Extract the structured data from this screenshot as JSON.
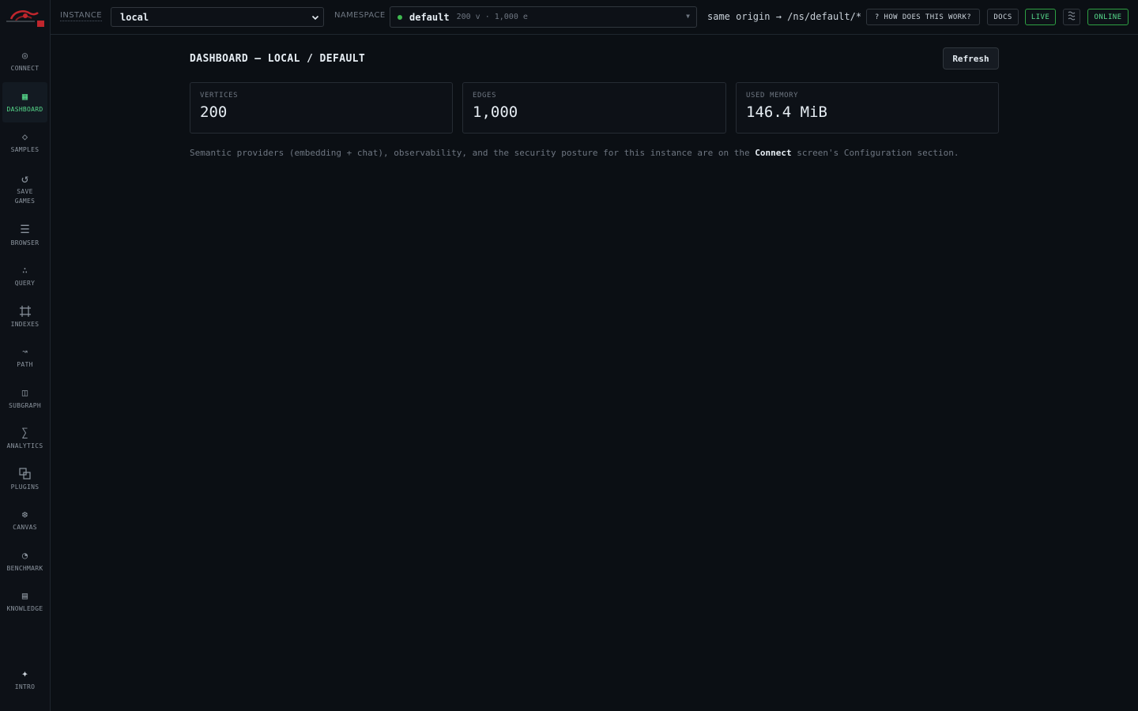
{
  "app": {
    "accent": "#56d98b"
  },
  "sidebar": {
    "items": [
      {
        "label": "CONNECT",
        "icon": "target-icon"
      },
      {
        "label": "DASHBOARD",
        "icon": "grid-icon",
        "active": true
      },
      {
        "label": "SAMPLES",
        "icon": "diamond-icon"
      },
      {
        "label": "SAVE GAMES",
        "icon": "refresh-icon"
      },
      {
        "label": "BROWSER",
        "icon": "list-icon"
      },
      {
        "label": "QUERY",
        "icon": "dots-icon"
      },
      {
        "label": "INDEXES",
        "icon": "frame-icon"
      },
      {
        "label": "PATH",
        "icon": "squiggle-icon"
      },
      {
        "label": "SUBGRAPH",
        "icon": "subgraph-icon"
      },
      {
        "label": "ANALYTICS",
        "icon": "sigma-icon"
      },
      {
        "label": "PLUGINS",
        "icon": "plugins-icon"
      },
      {
        "label": "CANVAS",
        "icon": "snowflake-icon"
      },
      {
        "label": "BENCHMARK",
        "icon": "gauge-icon"
      },
      {
        "label": "KNOWLEDGE",
        "icon": "book-icon"
      }
    ],
    "intro_label": "INTRO",
    "intro_icon": "sparkle-icon"
  },
  "topbar": {
    "instance_label": "INSTANCE",
    "instance_value": "local",
    "namespace_label": "NAMESPACE",
    "namespace_name": "default",
    "namespace_meta": "200 v · 1,000 e",
    "origin": "same origin → /ns/default/*",
    "how_label": "? HOW DOES THIS WORK?",
    "docs_label": "DOCS",
    "live_label": "LIVE",
    "online_label": "ONLINE",
    "status_color": "#3fb950"
  },
  "main": {
    "title": "DASHBOARD — LOCAL / DEFAULT",
    "refresh_label": "Refresh",
    "cards": [
      {
        "label": "VERTICES",
        "value": "200"
      },
      {
        "label": "EDGES",
        "value": "1,000"
      },
      {
        "label": "USED MEMORY",
        "value": "146.4 MiB"
      }
    ],
    "note_before": "Semantic providers (embedding + chat), observability, and the security posture for this instance are on the ",
    "note_link": "Connect",
    "note_after": " screen's Configuration section."
  }
}
